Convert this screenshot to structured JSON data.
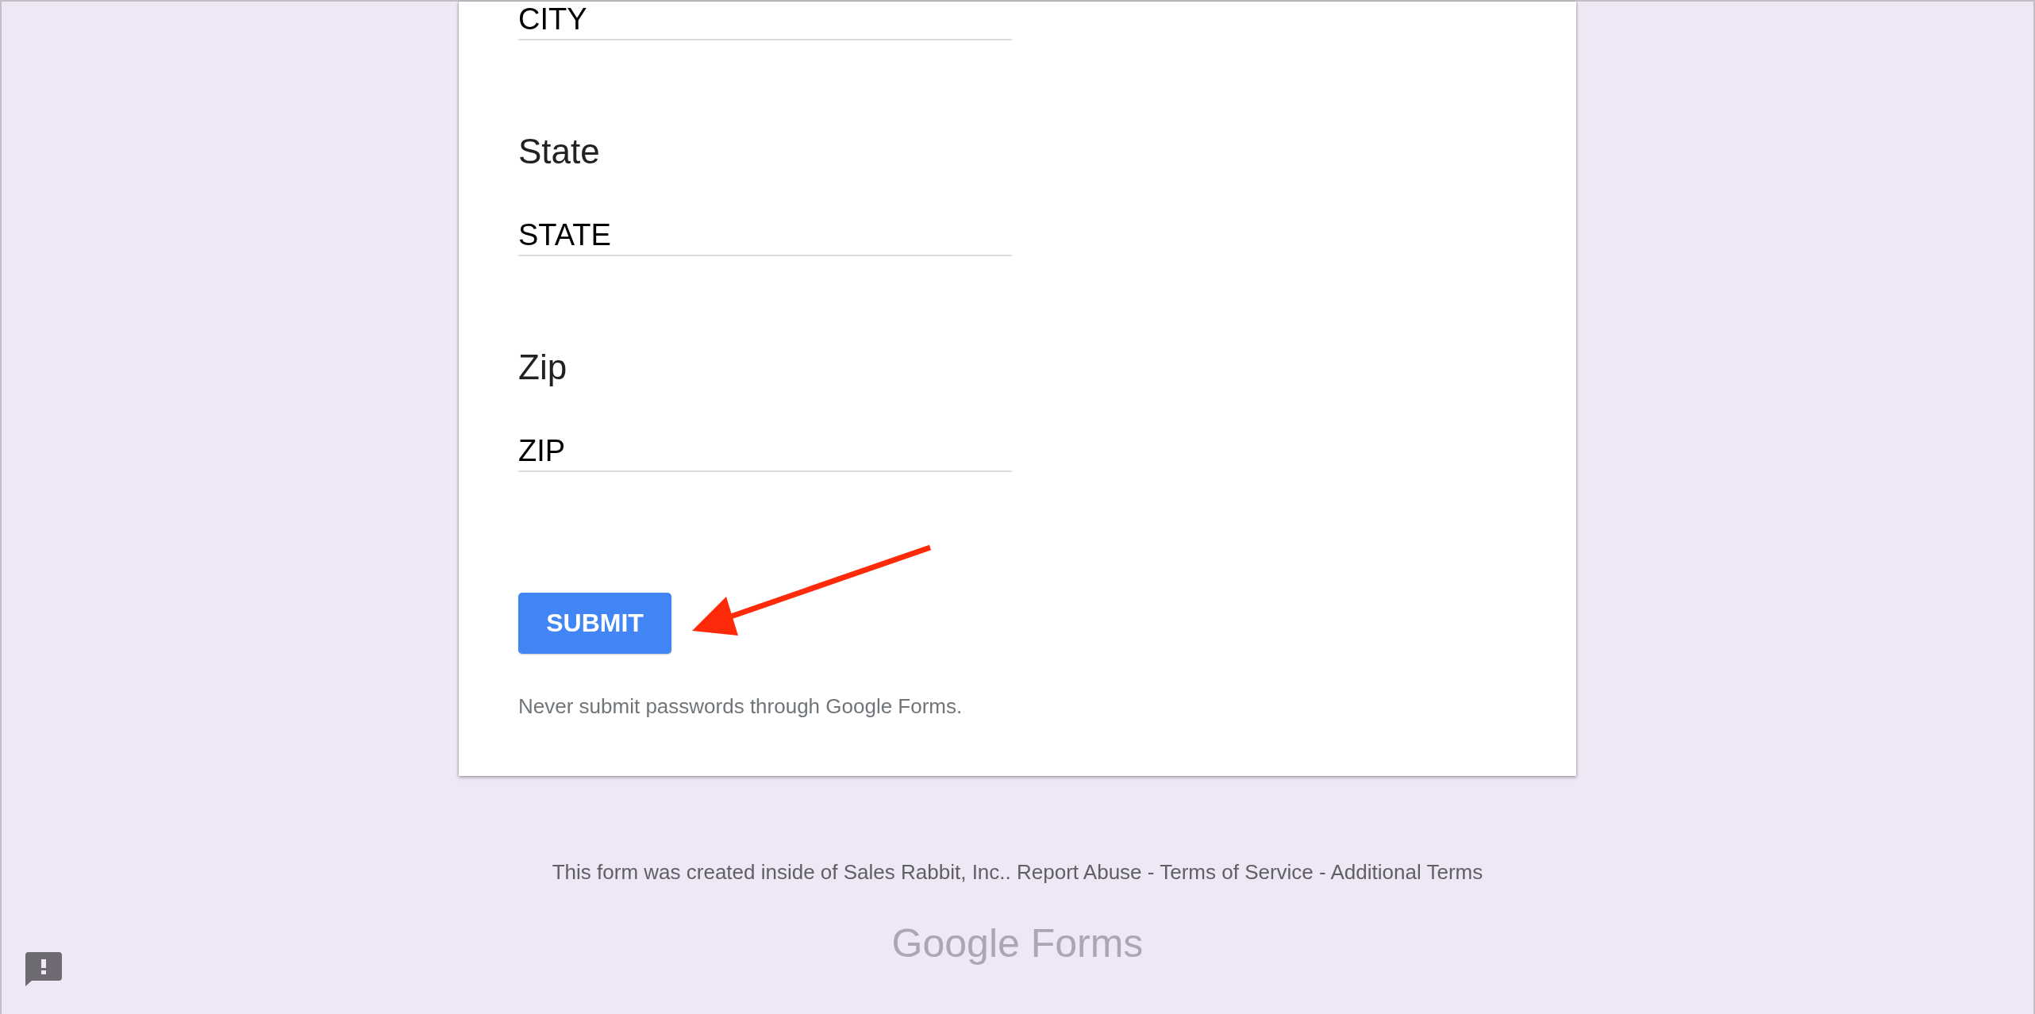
{
  "form": {
    "questions": [
      {
        "value": "CITY"
      },
      {
        "title": "State",
        "value": "STATE"
      },
      {
        "title": "Zip",
        "value": "ZIP"
      }
    ],
    "submit_button": "SUBMIT",
    "disclaimer": "Never submit passwords through Google Forms."
  },
  "annotations": [
    {
      "kind": "arrow"
    }
  ],
  "footer": {
    "note": "This form was created inside of Sales Rabbit, Inc..",
    "links": [
      {
        "label": "Report Abuse"
      },
      {
        "separator": "-",
        "label": "Terms of Service"
      },
      {
        "separator": "-",
        "label": "Additional Terms"
      }
    ],
    "logo": "Google Forms"
  }
}
